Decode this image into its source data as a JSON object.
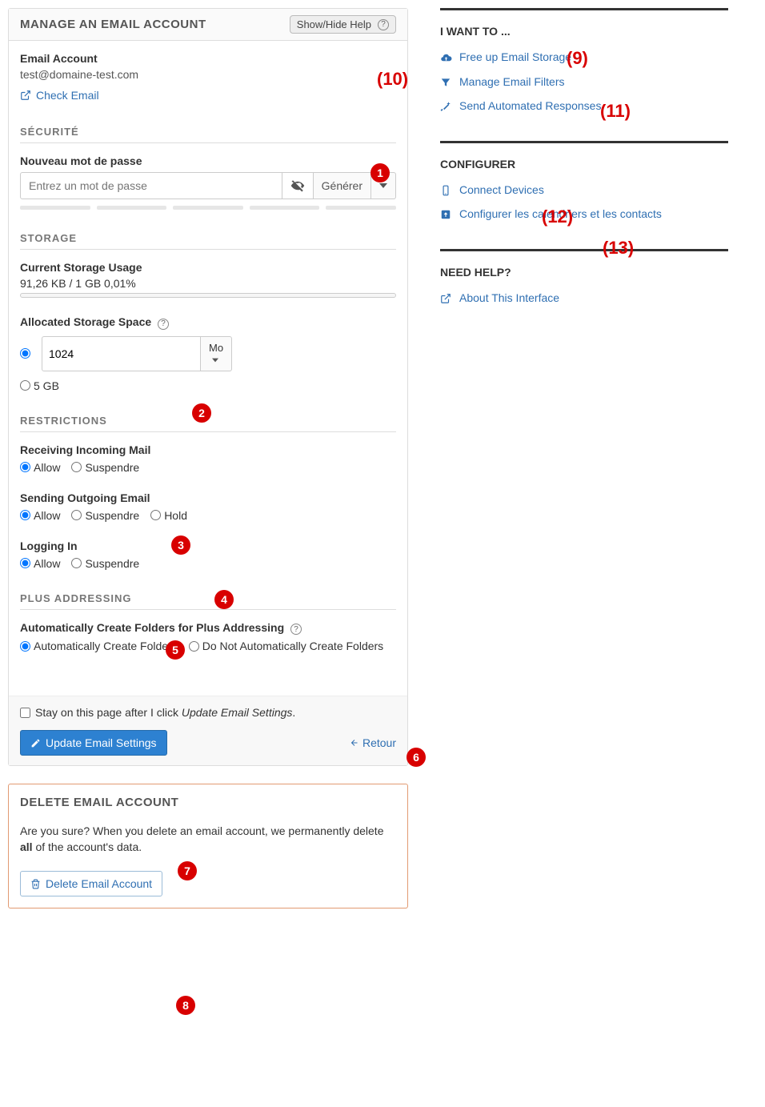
{
  "main": {
    "header_title": "MANAGE AN EMAIL ACCOUNT",
    "help_button": "Show/Hide Help",
    "email_account_label": "Email Account",
    "email_account_value": "test@domaine-test.com",
    "check_email": "Check Email",
    "security_title": "SÉCURITÉ",
    "new_password_label": "Nouveau mot de passe",
    "password_placeholder": "Entrez un mot de passe",
    "generate_label": "Générer",
    "storage_title": "STORAGE",
    "current_usage_label": "Current Storage Usage",
    "current_usage_value": "91,26 KB / 1 GB 0,01%",
    "allocated_label": "Allocated Storage Space",
    "allocated_value": "1024",
    "allocated_unit": "Mo",
    "allocated_alt_option": "5 GB",
    "restrictions_title": "RESTRICTIONS",
    "receiving_label": "Receiving Incoming Mail",
    "sending_label": "Sending Outgoing Email",
    "logging_label": "Logging In",
    "opt_allow": "Allow",
    "opt_suspend": "Suspendre",
    "opt_hold": "Hold",
    "plus_title": "PLUS ADDRESSING",
    "plus_label": "Automatically Create Folders for Plus Addressing",
    "plus_opt_yes": "Automatically Create Folders",
    "plus_opt_no": "Do Not Automatically Create Folders",
    "stay_checkbox_prefix": "Stay on this page after I click ",
    "stay_checkbox_em": "Update Email Settings",
    "stay_checkbox_suffix": ".",
    "update_button": "Update Email Settings",
    "back_link": "Retour",
    "delete_title": "DELETE EMAIL ACCOUNT",
    "delete_text_1": "Are you sure? When you delete an email account, we permanently delete ",
    "delete_text_bold": "all",
    "delete_text_2": " of the account's data.",
    "delete_button": "Delete Email Account"
  },
  "side": {
    "want_title": "I WANT TO ...",
    "want_free": "Free up Email Storage",
    "want_filters": "Manage Email Filters",
    "want_autoresp": "Send Automated Responses",
    "configure_title": "CONFIGURER",
    "cfg_devices": "Connect Devices",
    "cfg_caldav": "Configurer les calendriers et les contacts",
    "help_title": "NEED HELP?",
    "help_about": "About This Interface"
  }
}
